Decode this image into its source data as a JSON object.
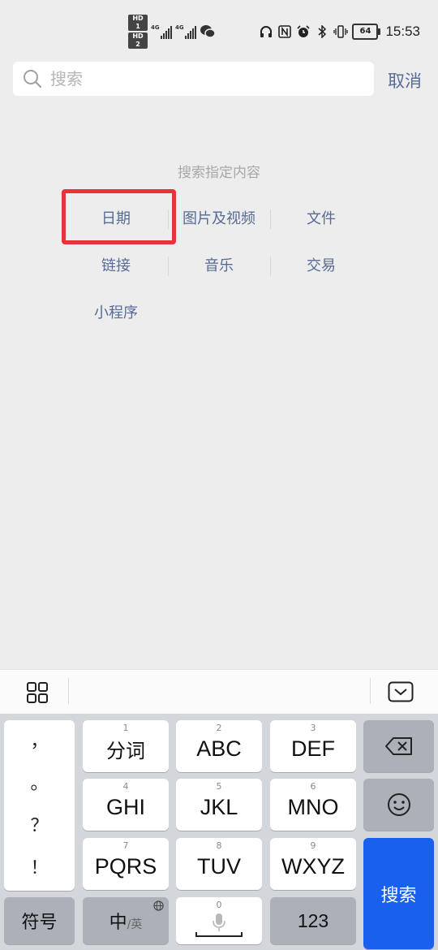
{
  "status": {
    "hd1": "HD 1",
    "hd2": "HD 2",
    "net1": "4G",
    "net2": "4G",
    "battery": "64",
    "time": "15:53",
    "icons": [
      "headphone-icon",
      "nfc-icon",
      "alarm-icon",
      "bluetooth-icon",
      "vibrate-icon",
      "battery-icon"
    ]
  },
  "search": {
    "placeholder": "搜索",
    "cancel_label": "取消"
  },
  "hint": "搜索指定内容",
  "categories": [
    "日期",
    "图片及视频",
    "文件",
    "链接",
    "音乐",
    "交易",
    "小程序"
  ],
  "highlight_color": "#e8333a",
  "accent_color": "#576b95",
  "keyboard": {
    "punct": [
      "，",
      "。",
      "？",
      "！"
    ],
    "keys": [
      {
        "num": "1",
        "label": "分词"
      },
      {
        "num": "2",
        "label": "ABC"
      },
      {
        "num": "3",
        "label": "DEF"
      },
      {
        "num": "4",
        "label": "GHI"
      },
      {
        "num": "5",
        "label": "JKL"
      },
      {
        "num": "6",
        "label": "MNO"
      },
      {
        "num": "7",
        "label": "PQRS"
      },
      {
        "num": "8",
        "label": "TUV"
      },
      {
        "num": "9",
        "label": "WXYZ"
      }
    ],
    "symbol_label": "符号",
    "lang_main": "中",
    "lang_sub": "/英",
    "space_num": "0",
    "num_label": "123",
    "search_label": "搜索",
    "search_color": "#1a60ef"
  }
}
